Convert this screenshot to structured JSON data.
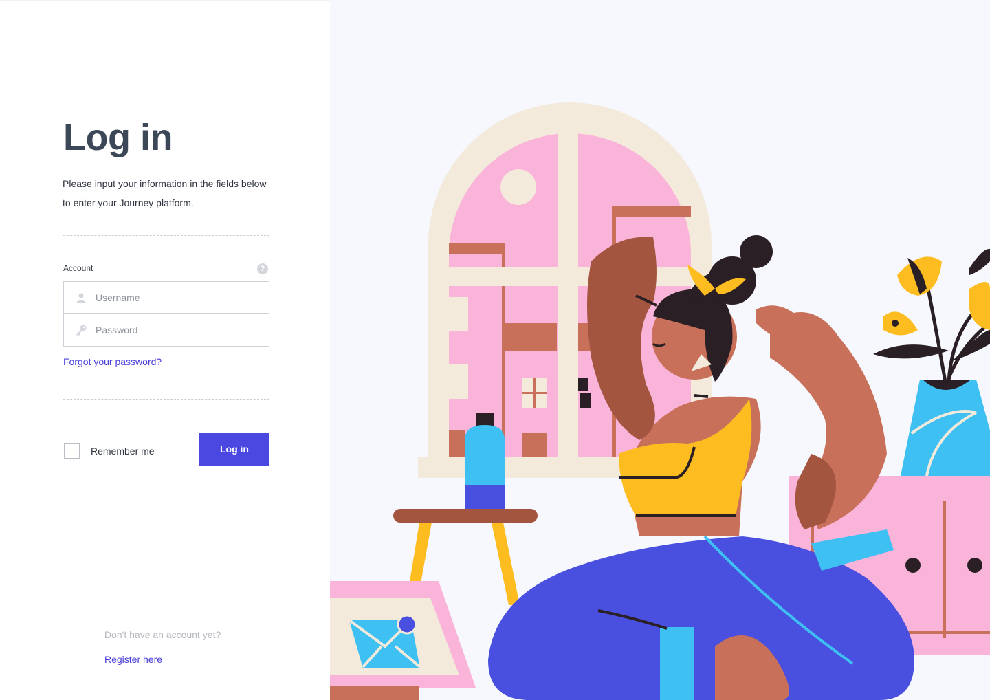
{
  "login": {
    "title": "Log in",
    "description": "Please input your information in the fields below to enter your Journey platform.",
    "account_label": "Account",
    "help_icon": "question-icon",
    "username_placeholder": "Username",
    "username_icon": "user-icon",
    "password_placeholder": "Password",
    "password_icon": "key-icon",
    "forgot_password": "Forgot your password?",
    "remember_me": "Remember me",
    "remember_checked": false,
    "login_button": "Log in"
  },
  "footer": {
    "no_account_text": "Don't have an account yet?",
    "register_link": "Register here"
  },
  "colors": {
    "primary": "#4a48e0",
    "link": "#4a3fd8",
    "title": "#3c4858",
    "illustration_background": "#f6f8fd"
  }
}
